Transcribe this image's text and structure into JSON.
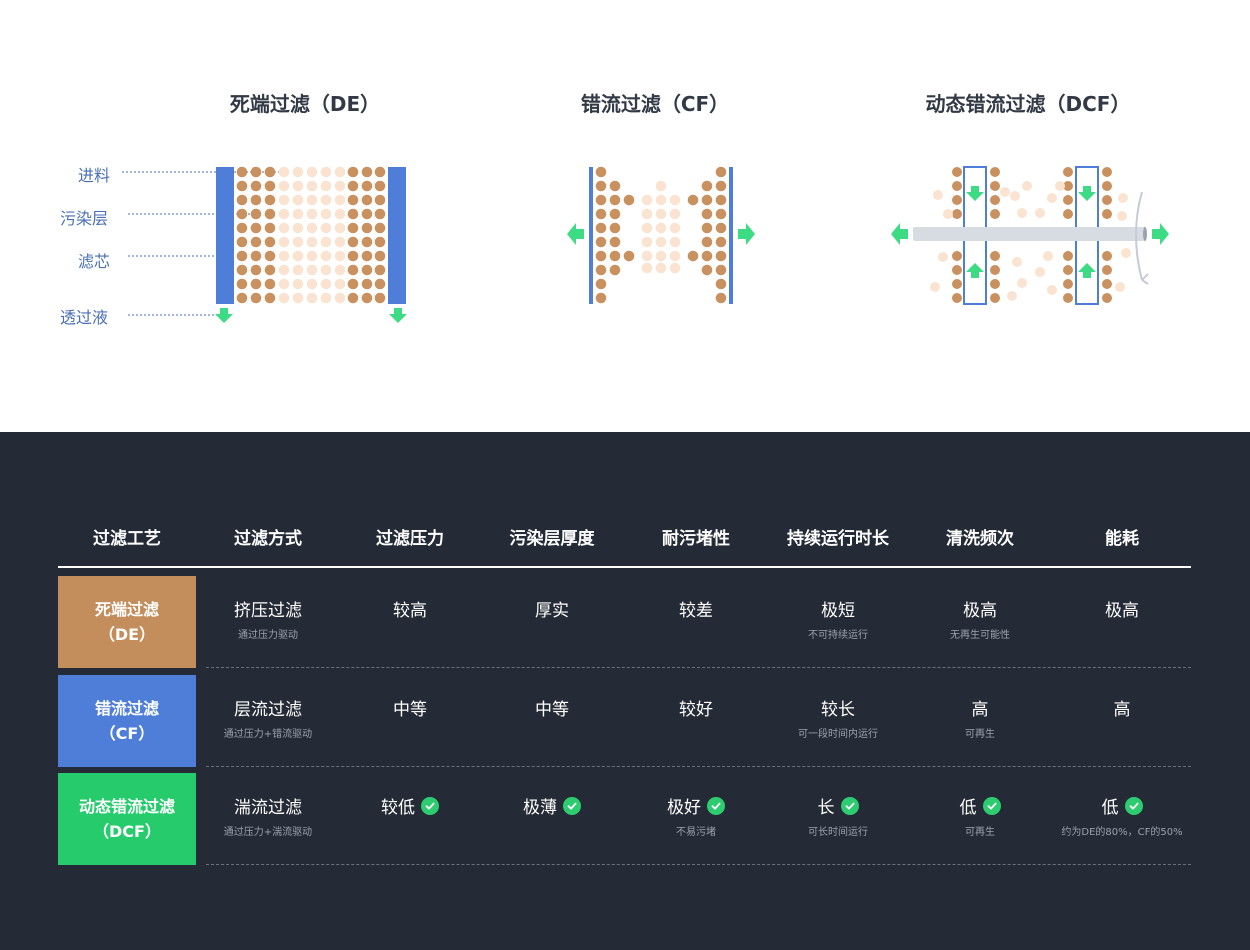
{
  "diagrams": {
    "de_title": "死端过滤（DE）",
    "cf_title": "错流过滤（CF）",
    "dcf_title": "动态错流过滤（DCF）",
    "callouts": [
      "进料",
      "污染层",
      "滤芯",
      "透过液"
    ]
  },
  "colors": {
    "de": "#c38d5c",
    "cf": "#4f7ed9",
    "dcf": "#26cc6c",
    "particle_dark": "#c8915f",
    "particle_light": "#fbe3d2",
    "arrow": "#3ddc84",
    "dark_bg": "#252b36"
  },
  "table": {
    "headers": [
      "过滤工艺",
      "过滤方式",
      "过滤压力",
      "污染层厚度",
      "耐污堵性",
      "持续运行时长",
      "清洗频次",
      "能耗"
    ],
    "rows": [
      {
        "label_line1": "死端过滤",
        "label_line2": "（DE）",
        "cells": [
          {
            "main": "挤压过滤",
            "sub": "通过压力驱动",
            "check": false
          },
          {
            "main": "较高",
            "sub": "",
            "check": false
          },
          {
            "main": "厚实",
            "sub": "",
            "check": false
          },
          {
            "main": "较差",
            "sub": "",
            "check": false
          },
          {
            "main": "极短",
            "sub": "不可持续运行",
            "check": false
          },
          {
            "main": "极高",
            "sub": "无再生可能性",
            "check": false
          },
          {
            "main": "极高",
            "sub": "",
            "check": false
          }
        ]
      },
      {
        "label_line1": "错流过滤",
        "label_line2": "（CF）",
        "cells": [
          {
            "main": "层流过滤",
            "sub": "通过压力+错流驱动",
            "check": false
          },
          {
            "main": "中等",
            "sub": "",
            "check": false
          },
          {
            "main": "中等",
            "sub": "",
            "check": false
          },
          {
            "main": "较好",
            "sub": "",
            "check": false
          },
          {
            "main": "较长",
            "sub": "可一段时间内运行",
            "check": false
          },
          {
            "main": "高",
            "sub": "可再生",
            "check": false
          },
          {
            "main": "高",
            "sub": "",
            "check": false
          }
        ]
      },
      {
        "label_line1": "动态错流过滤",
        "label_line2": "（DCF）",
        "cells": [
          {
            "main": "湍流过滤",
            "sub": "通过压力+湍流驱动",
            "check": false
          },
          {
            "main": "较低",
            "sub": "",
            "check": true
          },
          {
            "main": "极薄",
            "sub": "",
            "check": true
          },
          {
            "main": "极好",
            "sub": "不易污堵",
            "check": true
          },
          {
            "main": "长",
            "sub": "可长时间运行",
            "check": true
          },
          {
            "main": "低",
            "sub": "可再生",
            "check": true
          },
          {
            "main": "低",
            "sub": "约为DE的80%，CF的50%",
            "check": true
          }
        ]
      }
    ]
  }
}
